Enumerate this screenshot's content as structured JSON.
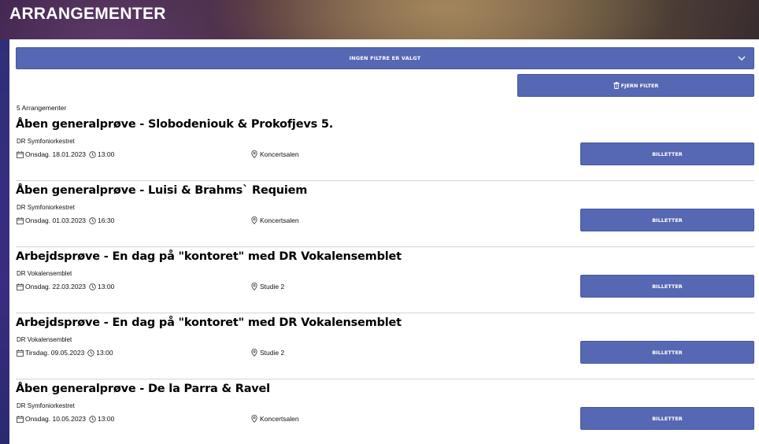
{
  "header": {
    "title": "ARRANGEMENTER"
  },
  "filter": {
    "label": "INGEN FILTRE ER VALGT",
    "icon": "chevron-down-icon"
  },
  "reset": {
    "label": "FJERN FILTER",
    "icon": "trash-icon"
  },
  "results": {
    "count_label": "5 Arrangementer"
  },
  "colors": {
    "button": "#5668b3",
    "divider": "#d4d4d4",
    "panel": "#ffffff"
  },
  "events": [
    {
      "title": "Åben generalprøve - Slobodeniouk & Prokofjevs 5.",
      "organizer": "DR Symfoniorkestret",
      "date": "Onsdag. 18.01.2023",
      "time": "13:00",
      "venue": "Koncertsalen",
      "button": "BILLETTER"
    },
    {
      "title": "Åben generalprøve - Luisi & Brahms` Requiem",
      "organizer": "DR Symfoniorkestret",
      "date": "Onsdag. 01.03.2023",
      "time": "16:30",
      "venue": "Koncertsalen",
      "button": "BILLETTER"
    },
    {
      "title": "Arbejdsprøve - En dag på \"kontoret\" med DR Vokalensemblet",
      "organizer": "DR Vokalensemblet",
      "date": "Onsdag. 22.03.2023",
      "time": "13:00",
      "venue": "Studie 2",
      "button": "BILLETTER"
    },
    {
      "title": "Arbejdsprøve - En dag på \"kontoret\" med DR Vokalensemblet",
      "organizer": "DR Vokalensemblet",
      "date": "Tirsdag. 09.05.2023",
      "time": "13:00",
      "venue": "Studie 2",
      "button": "BILLETTER"
    },
    {
      "title": "Åben generalprøve - De la Parra & Ravel",
      "organizer": "DR Symfoniorkestret",
      "date": "Onsdag. 10.05.2023",
      "time": "13:00",
      "venue": "Koncertsalen",
      "button": "BILLETTER"
    }
  ]
}
